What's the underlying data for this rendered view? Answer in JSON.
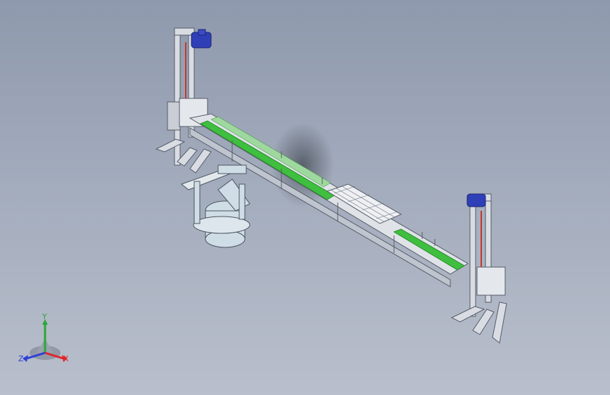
{
  "viewport": {
    "background_top": "#8f99ad",
    "background_bottom": "#b9bfcc",
    "model_description_icon": "3d-conveyor-gantry-assembly"
  },
  "triad": {
    "x_label": "X",
    "y_label": "Y",
    "z_label": "Z",
    "x_color": "#e0262b",
    "y_color": "#2aa836",
    "z_color": "#2d3fd6"
  },
  "colors": {
    "frame": "#d9dde3",
    "frame_edge": "#555b66",
    "belt": "#3fbf3f",
    "motor": "#2f3fb8",
    "robot": "#cfdde6"
  }
}
